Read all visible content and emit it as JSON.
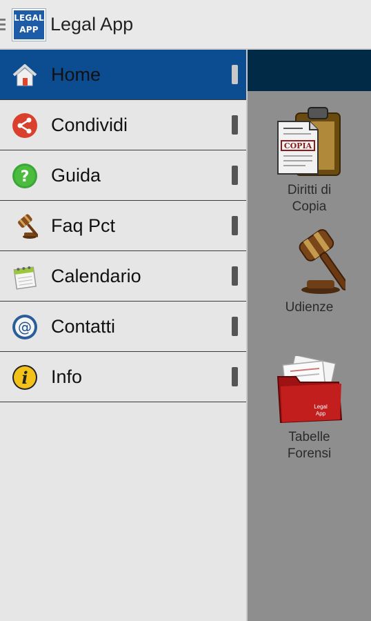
{
  "actionbar": {
    "logo_line1": "LEGAL",
    "logo_line2": "APP",
    "title": "Legal App"
  },
  "drawer": {
    "items": [
      {
        "label": "Home",
        "icon": "home-icon",
        "active": true
      },
      {
        "label": "Condividi",
        "icon": "share-icon",
        "active": false
      },
      {
        "label": "Guida",
        "icon": "help-icon",
        "active": false
      },
      {
        "label": "Faq Pct",
        "icon": "gavel-icon",
        "active": false
      },
      {
        "label": "Calendario",
        "icon": "calendar-icon",
        "active": false
      },
      {
        "label": "Contatti",
        "icon": "at-icon",
        "active": false
      },
      {
        "label": "Info",
        "icon": "info-icon",
        "active": false
      }
    ]
  },
  "content": {
    "tiles": [
      {
        "label_line1": "Diritti di",
        "label_line2": "Copia",
        "icon": "clipboard-copia-icon",
        "stamp": "COPIA"
      },
      {
        "label_line1": "Udienze",
        "label_line2": "",
        "icon": "gavel-icon"
      },
      {
        "label_line1": "Tabelle",
        "label_line2": "Forensi",
        "icon": "red-folder-icon",
        "folder_text_1": "Legal",
        "folder_text_2": "App"
      }
    ]
  },
  "colors": {
    "active_item": "#0b4d90",
    "content_bar": "#012a47",
    "content_overlay": "#8e8e8e",
    "logo_bg": "#1f5ca8"
  }
}
